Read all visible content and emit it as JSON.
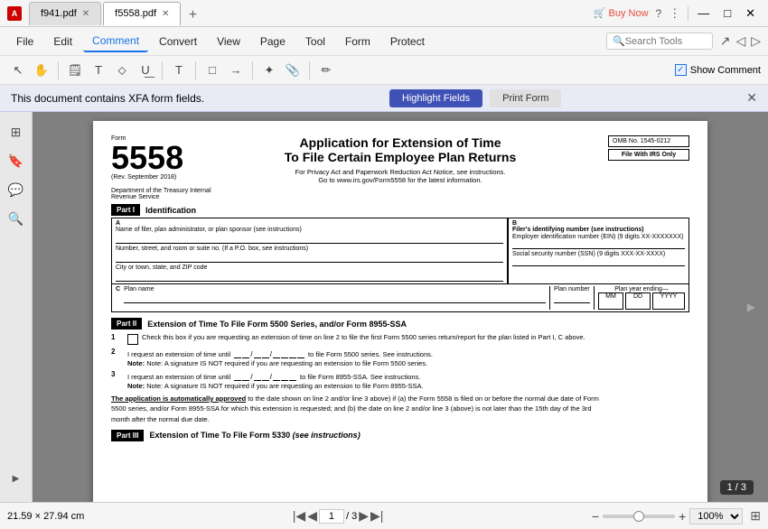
{
  "titleBar": {
    "appIcon": "A",
    "tabs": [
      {
        "id": "tab1",
        "label": "f941.pdf",
        "active": false
      },
      {
        "id": "tab2",
        "label": "f5558.pdf",
        "active": true
      }
    ],
    "newTab": "+",
    "windowControls": {
      "minimize": "—",
      "maximize": "□",
      "close": "✕"
    },
    "rightIcons": [
      "Buy Now",
      "?",
      "⋮",
      "—",
      "□",
      "✕"
    ]
  },
  "menuBar": {
    "items": [
      {
        "id": "file",
        "label": "File"
      },
      {
        "id": "edit",
        "label": "Edit"
      },
      {
        "id": "comment",
        "label": "Comment",
        "active": true
      },
      {
        "id": "convert",
        "label": "Convert"
      },
      {
        "id": "view",
        "label": "View"
      },
      {
        "id": "page",
        "label": "Page"
      },
      {
        "id": "tool",
        "label": "Tool"
      },
      {
        "id": "form",
        "label": "Form"
      },
      {
        "id": "protect",
        "label": "Protect"
      }
    ],
    "searchPlaceholder": "Search Tools"
  },
  "toolbar": {
    "showCommentLabel": "Show Comment",
    "checkboxChecked": true
  },
  "xfaBar": {
    "message": "This document contains XFA form fields.",
    "highlightBtn": "Highlight Fields",
    "printFormBtn": "Print Form"
  },
  "document": {
    "formNumber": "5558",
    "formLabel": "Form",
    "formDate": "(Rev. September 2018)",
    "formTitle": "Application for Extension of Time",
    "formTitleLine2": "To File Certain Employee Plan Returns",
    "formSubtitle": "For Privacy Act and Paperwork Reduction Act Notice, see instructions.",
    "formSubtitle2": "Go to www.irs.gov/Form5558 for the latest information.",
    "ombNumber": "OMB No. 1545-0212",
    "department": "Department of the Treasury Internal",
    "revenueService": "Revenue Service",
    "fileWithIRS": "File With IRS Only",
    "partI": "Part I",
    "identificationLabel": "Identification",
    "labelA": "A",
    "labelB": "B",
    "fieldA1": "Name of filer, plan administrator, or plan sponsor (see instructions)",
    "fieldB1": "Filer's identifying number (see instructions)",
    "fieldB2": "Employer identification number (EIN) (9 digits XX-XXXXXXX)",
    "fieldB3": "Social security number (SSN) (9 digits XXX-XX-XXXX)",
    "labelNameStreet": "Number, street, and room or suite no. (If a P.O. box, see instructions)",
    "labelCity": "City or town, state, and ZIP code",
    "labelC": "C",
    "planNameLabel": "Plan name",
    "planNumberLabel": "Plan\nnumber",
    "planYearEndingLabel": "Plan year ending—",
    "mmLabel": "MM",
    "ddLabel": "DD",
    "yyyyLabel": "YYYY",
    "partII": "Part II",
    "partIILabel": "Extension of Time To File Form 5500 Series, and/or Form 8955-SSA",
    "item1": "1",
    "checkbox1Label": "Check this box if you are requesting an extension of time on line 2 to file the first Form 5500 series return/report for the plan listed in Part I, C above.",
    "item2": "2",
    "item2Label": "I request an extension of time until",
    "item2Label2": "to file Form 5500 series. See instructions.",
    "item2Note": "Note: A signature IS NOT required if you are requesting an extension to file Form 5500 series.",
    "item3": "3",
    "item3Label": "I request an extension of time until",
    "item3Label2": "to file Form 8955-SSA. See instructions.",
    "item3Note": "Note: A signature IS NOT required if you are requesting an extension to file Form 8955-SSA.",
    "autoApproved": "The application is automatically approved",
    "autoApprovedText1": "to the date shown on line 2 and/or line 3 above) if (a) the Form 5558 is filed on or before the normal due date of Form",
    "autoApprovedText2": "5500 series, and/or Form 8955-SSA for which this extension is requested; and (b) the date on line 2  and/or line 3 (above) is not later than the 15th day of the 3rd",
    "autoApprovedText3": "month after the normal due date.",
    "partIII": "Part III",
    "partIIILabel": "Extension of Time To File Form 5330",
    "partIIISuffix": "(see instructions)"
  },
  "bottomBar": {
    "pageSize": "21.59 × 27.94 cm",
    "currentPage": "1",
    "totalPages": "3",
    "pageDisplay": "1 / 3",
    "zoomLevel": "100%"
  }
}
